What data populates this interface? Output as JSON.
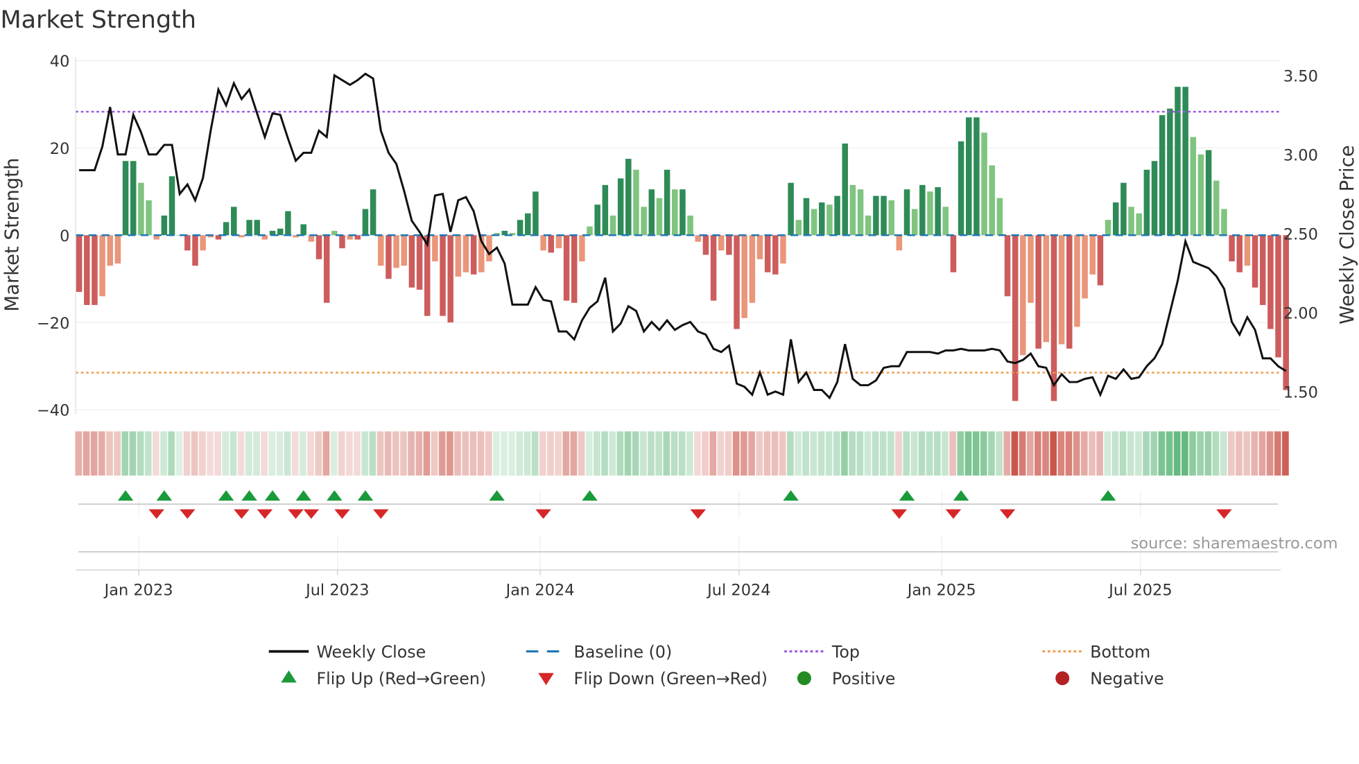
{
  "chart_data": {
    "type": "bar",
    "title": "Market Strength",
    "ylabel": "Market Strength",
    "y2label": "Weekly Close Price",
    "ylim": [
      -40,
      40
    ],
    "y2lim": [
      1.5,
      3.5
    ],
    "yticks": [
      40,
      20,
      0,
      -20,
      -40
    ],
    "ytick_labels": [
      "40",
      "20",
      "0",
      "−20",
      "−40"
    ],
    "y2ticks": [
      3.5,
      3.0,
      2.5,
      2.0,
      1.5
    ],
    "y2tick_labels": [
      "3.50",
      "3.00",
      "2.50",
      "2.00",
      "1.50"
    ],
    "x_unit": "week index",
    "xticks": [
      {
        "week": 7.7,
        "label": "Jan 2023"
      },
      {
        "week": 33.4,
        "label": "Jul 2023"
      },
      {
        "week": 59.6,
        "label": "Jan 2024"
      },
      {
        "week": 85.3,
        "label": "Jul 2024"
      },
      {
        "week": 111.5,
        "label": "Jan 2025"
      },
      {
        "week": 137.2,
        "label": "Jul 2025"
      }
    ],
    "top_level": 28.3,
    "bottom_level": -31.5,
    "baseline": 0,
    "strength": [
      -13,
      -16,
      -16,
      -14,
      -7,
      -6.5,
      17,
      17,
      12,
      8,
      -1,
      4.5,
      13.5,
      0,
      -3.5,
      -7,
      -3.5,
      -0.5,
      -1,
      3,
      6.5,
      -0.5,
      3.5,
      3.5,
      -1,
      1,
      1.5,
      5.5,
      -0.5,
      2.5,
      -1.5,
      -5.5,
      -15.5,
      1,
      -3,
      -1,
      -1,
      6,
      10.5,
      -7,
      -10,
      -7.5,
      -7,
      -12,
      -12.5,
      -18.5,
      -6,
      -18.5,
      -20,
      -9.5,
      -8.5,
      -9,
      -8.5,
      -6,
      0.5,
      1,
      0.5,
      3.5,
      5,
      10,
      -3.5,
      -4,
      -3,
      -15,
      -15.5,
      -6,
      2,
      7,
      11.5,
      4.5,
      13,
      17.5,
      15,
      6.5,
      10.5,
      8.5,
      15,
      10.5,
      10.5,
      4.5,
      -1.5,
      -4.5,
      -15,
      -3.5,
      -4.5,
      -21.5,
      -19,
      -15.5,
      -5.5,
      -8.5,
      -9,
      -6.5,
      12,
      3.5,
      8.5,
      6,
      7.5,
      7,
      9,
      21,
      11.5,
      10.5,
      4.5,
      9,
      9,
      8,
      -3.5,
      10.5,
      6,
      11.5,
      10,
      11,
      6.5,
      -8.5,
      21.5,
      27,
      27,
      23.5,
      16,
      8.5,
      -14,
      -38,
      -27.5,
      -15.5,
      -26,
      -24.5,
      -38,
      -25,
      -26,
      -21,
      -14.5,
      -9,
      -11.5,
      3.5,
      7.5,
      12,
      6.5,
      5,
      15,
      17,
      27.5,
      29,
      34,
      34,
      22.5,
      18.5,
      19.5,
      12.5,
      6,
      -6,
      -8.5,
      -7,
      -12,
      -16,
      -21.5,
      -28,
      -35.5
    ],
    "weekly_close": [
      2.9,
      2.9,
      2.9,
      3.05,
      3.3,
      3.0,
      3.0,
      3.25,
      3.14,
      3.0,
      3.0,
      3.06,
      3.06,
      2.75,
      2.81,
      2.71,
      2.85,
      3.15,
      3.41,
      3.31,
      3.45,
      3.35,
      3.41,
      3.26,
      3.11,
      3.26,
      3.25,
      3.1,
      2.96,
      3.01,
      3.01,
      3.15,
      3.11,
      3.5,
      3.47,
      3.44,
      3.47,
      3.51,
      3.48,
      3.15,
      3.01,
      2.94,
      2.77,
      2.58,
      2.51,
      2.43,
      2.74,
      2.75,
      2.51,
      2.71,
      2.73,
      2.64,
      2.45,
      2.37,
      2.41,
      2.31,
      2.05,
      2.05,
      2.05,
      2.16,
      2.08,
      2.07,
      1.88,
      1.88,
      1.83,
      1.95,
      2.03,
      2.07,
      2.22,
      1.88,
      1.93,
      2.04,
      2.01,
      1.88,
      1.94,
      1.89,
      1.95,
      1.89,
      1.92,
      1.94,
      1.88,
      1.86,
      1.77,
      1.75,
      1.79,
      1.55,
      1.53,
      1.48,
      1.62,
      1.48,
      1.5,
      1.48,
      1.83,
      1.56,
      1.62,
      1.51,
      1.51,
      1.46,
      1.56,
      1.8,
      1.58,
      1.54,
      1.54,
      1.57,
      1.65,
      1.66,
      1.66,
      1.75,
      1.75,
      1.75,
      1.75,
      1.74,
      1.76,
      1.76,
      1.77,
      1.76,
      1.76,
      1.76,
      1.77,
      1.76,
      1.69,
      1.68,
      1.7,
      1.74,
      1.66,
      1.65,
      1.54,
      1.61,
      1.56,
      1.56,
      1.58,
      1.59,
      1.48,
      1.6,
      1.58,
      1.64,
      1.58,
      1.59,
      1.66,
      1.71,
      1.8,
      2.0,
      2.2,
      2.45,
      2.32,
      2.3,
      2.28,
      2.23,
      2.15,
      1.94,
      1.86,
      1.97,
      1.89,
      1.71,
      1.71,
      1.66,
      1.63
    ],
    "flip_up_weeks": [
      6,
      11,
      19,
      22,
      25,
      29,
      33,
      37,
      54,
      66,
      92,
      107,
      114,
      133
    ],
    "flip_down_weeks": [
      10,
      14,
      21,
      24,
      28,
      30,
      34,
      39,
      60,
      80,
      106,
      113,
      120,
      148
    ],
    "source": "source: sharemaestro.com",
    "legend": [
      {
        "label": "Weekly Close",
        "kind": "line",
        "color": "#111111"
      },
      {
        "label": "Baseline (0)",
        "kind": "dash",
        "color": "#1f77b4"
      },
      {
        "label": "Top",
        "kind": "dot",
        "color": "#9b59e6"
      },
      {
        "label": "Bottom",
        "kind": "dot",
        "color": "#f0a050"
      },
      {
        "label": "Flip Up (Red→Green)",
        "kind": "tri-up",
        "color": "#1a9a3a"
      },
      {
        "label": "Flip Down (Green→Red)",
        "kind": "tri-down",
        "color": "#d62728"
      },
      {
        "label": "Positive",
        "kind": "circle",
        "color": "#228b22"
      },
      {
        "label": "Negative",
        "kind": "circle",
        "color": "#b22222"
      }
    ],
    "legend_placement": "bottom",
    "colors": {
      "pos_dark": "#2e8b57",
      "pos_light": "#7fc47f",
      "neg_dark": "#cd5c5c",
      "neg_light": "#e9967a"
    }
  }
}
